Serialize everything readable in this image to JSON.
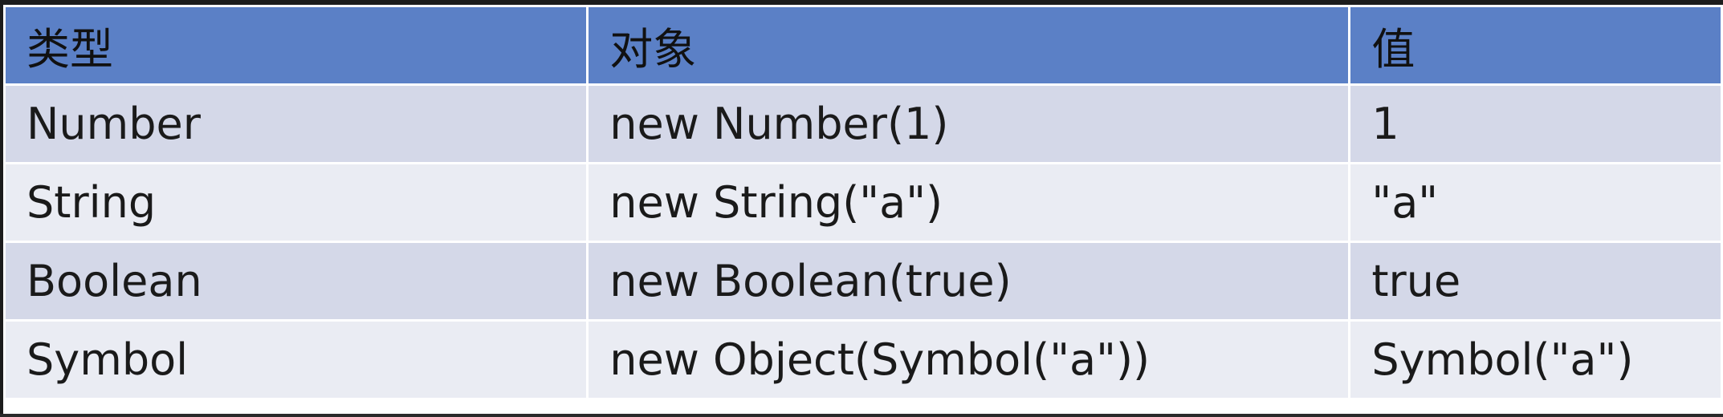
{
  "table": {
    "headers": [
      "类型",
      "对象",
      "值"
    ],
    "rows": [
      [
        "Number",
        "new Number(1)",
        "1"
      ],
      [
        "String",
        "new String(\"a\")",
        "\"a\""
      ],
      [
        "Boolean",
        "new Boolean(true)",
        "true"
      ],
      [
        "Symbol",
        "new Object(Symbol(\"a\"))",
        "Symbol(\"a\")"
      ]
    ]
  },
  "colors": {
    "header_bg": "#5b80c6",
    "row_odd_bg": "#d4d8e8",
    "row_even_bg": "#eaecf3",
    "border": "#ffffff"
  }
}
